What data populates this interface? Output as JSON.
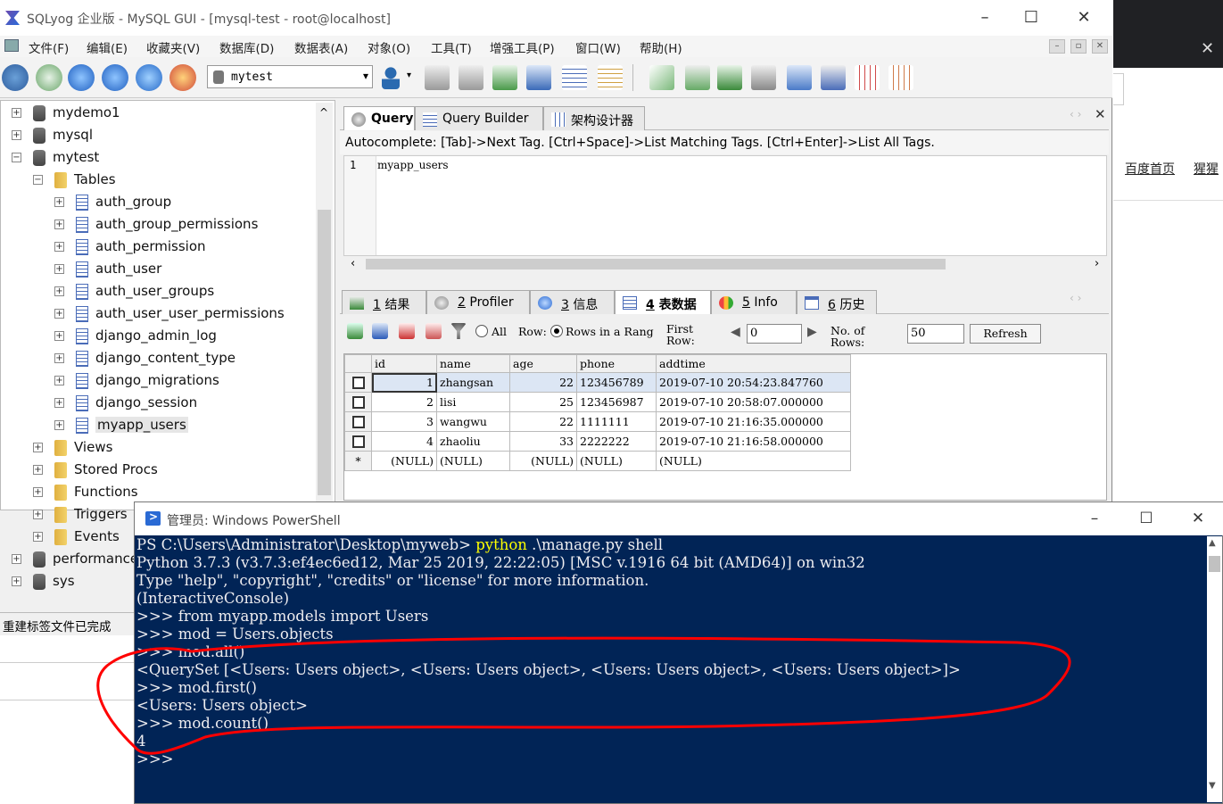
{
  "window": {
    "title": "SQLyog 企业版 - MySQL GUI - [mysql-test - root@localhost]"
  },
  "menu": [
    "文件(F)",
    "编辑(E)",
    "收藏夹(V)",
    "数据库(D)",
    "数据表(A)",
    "对象(O)",
    "工具(T)",
    "增强工具(P)",
    "窗口(W)",
    "帮助(H)"
  ],
  "toolbar": {
    "db_select": "mytest"
  },
  "tree": {
    "top_items": [
      {
        "label": "mydemo1",
        "expanded": false
      },
      {
        "label": "mysql",
        "expanded": false
      },
      {
        "label": "mytest",
        "expanded": true
      }
    ],
    "tables_label": "Tables",
    "tables": [
      "auth_group",
      "auth_group_permissions",
      "auth_permission",
      "auth_user",
      "auth_user_groups",
      "auth_user_user_permissions",
      "django_admin_log",
      "django_content_type",
      "django_migrations",
      "django_session",
      "myapp_users"
    ],
    "folders": [
      "Views",
      "Stored Procs",
      "Functions",
      "Triggers",
      "Events"
    ],
    "bottom_items": [
      "performance",
      "sys"
    ]
  },
  "status_left": "重建标签文件已完成",
  "query_tabs": [
    {
      "label": "Query",
      "active": true
    },
    {
      "label": "Query Builder",
      "active": false
    },
    {
      "label": "架构设计器",
      "active": false
    }
  ],
  "autocomplete_hint": "Autocomplete: [Tab]->Next Tag. [Ctrl+Space]->List Matching Tags. [Ctrl+Enter]->List All Tags.",
  "editor": {
    "line_no": "1",
    "code": "myapp_users"
  },
  "result_tabs": [
    {
      "num": "1",
      "label": "结果",
      "active": false
    },
    {
      "num": "2",
      "label": "Profiler",
      "active": false
    },
    {
      "num": "3",
      "label": "信息",
      "active": false
    },
    {
      "num": "4",
      "label": "表数据",
      "active": true
    },
    {
      "num": "5",
      "label": "Info",
      "active": false
    },
    {
      "num": "6",
      "label": "历史",
      "active": false
    }
  ],
  "grid_toolbar": {
    "all_label": "All",
    "row_label": "Row:",
    "rows_in_range_label": "Rows in a Rang",
    "first_row_label_1": "First",
    "first_row_label_2": "Row:",
    "first_row_value": "0",
    "num_rows_label_1": "No. of",
    "num_rows_label_2": "Rows:",
    "num_rows_value": "50",
    "refresh_label": "Refresh"
  },
  "grid": {
    "columns": [
      "id",
      "name",
      "age",
      "phone",
      "addtime"
    ],
    "rows": [
      [
        "1",
        "zhangsan",
        "22",
        "123456789",
        "2019-07-10 20:54:23.847760"
      ],
      [
        "2",
        "lisi",
        "25",
        "123456987",
        "2019-07-10 20:58:07.000000"
      ],
      [
        "3",
        "wangwu",
        "22",
        "1111111",
        "2019-07-10 21:16:35.000000"
      ],
      [
        "4",
        "zhaoliu",
        "33",
        "2222222",
        "2019-07-10 21:16:58.000000"
      ]
    ],
    "new_row": [
      "(NULL)",
      "(NULL)",
      "(NULL)",
      "(NULL)",
      "(NULL)"
    ],
    "new_row_marker": "*"
  },
  "browser": {
    "links": [
      "百度首页",
      "猩猩"
    ]
  },
  "powershell": {
    "title": "管理员: Windows PowerShell",
    "lines": [
      {
        "prompt": "PS C:\\Users\\Administrator\\Desktop\\myweb> ",
        "cmd": "python",
        "rest": " .\\manage.py shell"
      },
      {
        "text": "Python 3.7.3 (v3.7.3:ef4ec6ed12, Mar 25 2019, 22:22:05) [MSC v.1916 64 bit (AMD64)] on win32"
      },
      {
        "text": "Type \"help\", \"copyright\", \"credits\" or \"license\" for more information."
      },
      {
        "text": "(InteractiveConsole)"
      },
      {
        "text": ">>> from myapp.models import Users"
      },
      {
        "text": ">>> mod = Users.objects"
      },
      {
        "text": ">>> mod.all()"
      },
      {
        "text": "<QuerySet [<Users: Users object>, <Users: Users object>, <Users: Users object>, <Users: Users object>]>"
      },
      {
        "text": ">>> mod.first()"
      },
      {
        "text": "<Users: Users object>"
      },
      {
        "text": ">>> mod.count()"
      },
      {
        "text": "4"
      },
      {
        "text": ">>>"
      }
    ]
  },
  "colors": {
    "ps_bg": "#012456",
    "ps_fg": "#eeedf0",
    "ps_cmd": "#ffff00",
    "annotation": "#ff0000"
  }
}
